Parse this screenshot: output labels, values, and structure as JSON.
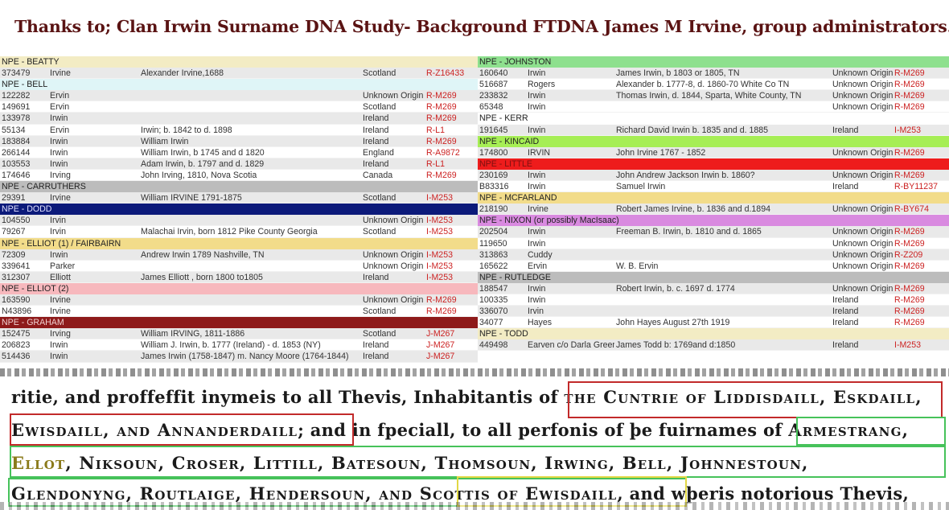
{
  "header": {
    "title": "Thanks to; Clan Irwin Surname DNA Study- Background FTDNA James M Irvine, group administrators."
  },
  "colors": {
    "title": "#5a1313",
    "haplogroup": "#cc2222",
    "box_red": "#c22a2a",
    "box_green": "#46c25a",
    "box_yellow": "#e2d845"
  },
  "left_groups": [
    {
      "name": "NPE - BEATTY",
      "color": "#f3ecc4",
      "text": "#222222",
      "rows": [
        [
          "373479",
          "Irvine",
          "Alexander Irvine,1688",
          "Scotland",
          "R-Z16433"
        ]
      ]
    },
    {
      "name": "NPE - BELL",
      "color": "#dff5f7",
      "text": "#222222",
      "rows": [
        [
          "122282",
          "Ervin",
          "",
          "Unknown Origin",
          "R-M269"
        ],
        [
          "149691",
          "Ervin",
          "",
          "Scotland",
          "R-M269"
        ],
        [
          "133978",
          "Irwin",
          "",
          "Ireland",
          "R-M269"
        ],
        [
          "55134",
          "Ervin",
          "Irwin; b. 1842 to d. 1898",
          "Ireland",
          "R-L1"
        ],
        [
          "183884",
          "Irwin",
          "William Irwin",
          "Ireland",
          "R-M269"
        ],
        [
          "266144",
          "Irwin",
          "William Irwin, b 1745 and d 1820",
          "England",
          "R-A9872"
        ],
        [
          "103553",
          "Irwin",
          "Adam Irwin, b. 1797 and d. 1829",
          "Ireland",
          "R-L1"
        ],
        [
          "174646",
          "Irving",
          "John Irving, 1810, Nova Scotia",
          "Canada",
          "R-M269"
        ]
      ]
    },
    {
      "name": "NPE - CARRUTHERS",
      "color": "#bcbcbc",
      "text": "#222222",
      "rows": [
        [
          "29391",
          "Irvine",
          "William IRVINE 1791-1875",
          "Scotland",
          "I-M253"
        ]
      ]
    },
    {
      "name": "NPE - DODD",
      "color": "#0c1a7a",
      "text": "#e0e0ff",
      "rows": [
        [
          "104550",
          "Irvin",
          "",
          "Unknown Origin",
          "I-M253"
        ],
        [
          "79267",
          "Irvin",
          "Malachai Irvin, born 1812 Pike County Georgia",
          "Scotland",
          "I-M253"
        ]
      ]
    },
    {
      "name": "NPE - ELLIOT (1) / FAIRBAIRN",
      "color": "#f2dc8a",
      "text": "#222222",
      "rows": [
        [
          "72309",
          "Irwin",
          "Andrew Irwin 1789 Nashville, TN",
          "Unknown Origin",
          "I-M253"
        ],
        [
          "339641",
          "Parker",
          "",
          "Unknown Origin",
          "I-M253"
        ],
        [
          "312307",
          "Elliott",
          "James Elliott , born 1800 to1805",
          "Ireland",
          "I-M253"
        ]
      ]
    },
    {
      "name": "NPE - ELLIOT (2)",
      "color": "#f7b8bd",
      "text": "#222222",
      "rows": [
        [
          "163590",
          "Irvine",
          "",
          "Unknown Origin",
          "R-M269"
        ],
        [
          "N43896",
          "Irvine",
          "",
          "Scotland",
          "R-M269"
        ]
      ]
    },
    {
      "name": "NPE - GRAHAM",
      "color": "#8e1a1a",
      "text": "#f0d0d0",
      "rows": [
        [
          "152475",
          "Irving",
          "William IRVING, 1811-1886",
          "Scotland",
          "J-M267"
        ],
        [
          "206823",
          "Irwin",
          "William J. Irwin, b. 1777 (Ireland) - d. 1853 (NY)",
          "Ireland",
          "J-M267"
        ],
        [
          "514436",
          "Irwin",
          "James Irwin (1758-1847) m. Nancy Moore (1764-1844)",
          "Ireland",
          "J-M267"
        ]
      ]
    }
  ],
  "right_groups": [
    {
      "name": "NPE - JOHNSTON",
      "color": "#8ee08e",
      "text": "#222222",
      "rows": [
        [
          "160640",
          "Irwin",
          "James Irwin, b 1803 or 1805, TN",
          "Unknown Origin",
          "R-M269"
        ],
        [
          "516687",
          "Rogers",
          "Alexander b. 1777-8, d. 1860-70 White Co TN",
          "Unknown Origin",
          "R-M269"
        ],
        [
          "233832",
          "Irwin",
          "Thomas Irwin, d. 1844, Sparta, White County, TN",
          "Unknown Origin",
          "R-M269"
        ],
        [
          "65348",
          "Irwin",
          "",
          "Unknown Origin",
          "R-M269"
        ]
      ]
    },
    {
      "name": "NPE - KERR",
      "color": "#ffffff",
      "text": "#222222",
      "rows": [
        [
          "191645",
          "Irwin",
          "Richard David Irwin b. 1835 and d. 1885",
          "Ireland",
          "I-M253"
        ]
      ]
    },
    {
      "name": "NPE - KINCAID",
      "color": "#a6ee55",
      "text": "#222222",
      "rows": [
        [
          "174800",
          "IRVIN",
          "John Irvine 1767 - 1852",
          "Unknown Origin",
          "R-M269"
        ]
      ]
    },
    {
      "name": "NPE - LITTLE",
      "color": "#ee1c1c",
      "text": "#7a1010",
      "rows": [
        [
          "230169",
          "Irwin",
          "John Andrew Jackson Irwin b. 1860?",
          "Unknown Origin",
          "R-M269"
        ],
        [
          "B83316",
          "Irwin",
          "Samuel Irwin",
          "Ireland",
          "R-BY11237"
        ]
      ]
    },
    {
      "name": "NPE - MCFARLAND",
      "color": "#f2dc8a",
      "text": "#222222",
      "rows": [
        [
          "218190",
          "Irvine",
          "Robert James Irvine, b. 1836 and d.1894",
          "Unknown Origin",
          "R-BY674"
        ]
      ]
    },
    {
      "name": "NPE - NIXON (or possibly MacIsaac)",
      "color": "#d98ae0",
      "text": "#222222",
      "rows": [
        [
          "202504",
          "Irwin",
          "Freeman B. Irwin, b. 1810 and d. 1865",
          "Unknown Origin",
          "R-M269"
        ],
        [
          "119650",
          "Irwin",
          "",
          "Unknown Origin",
          "R-M269"
        ],
        [
          "313863",
          "Cuddy",
          "",
          "Unknown Origin",
          "R-Z209"
        ],
        [
          "165622",
          "Ervin",
          "W. B. Ervin",
          "Unknown Origin",
          "R-M269"
        ]
      ]
    },
    {
      "name": "NPE - RUTLEDGE",
      "color": "#bcbcbc",
      "text": "#222222",
      "rows": [
        [
          "188547",
          "Irwin",
          "Robert Irwin, b. c. 1697 d. 1774",
          "Unknown Origin",
          "R-M269"
        ],
        [
          "100335",
          "Irwin",
          "",
          "Ireland",
          "R-M269"
        ],
        [
          "336070",
          "Irvin",
          "",
          "Ireland",
          "R-M269"
        ],
        [
          "34077",
          "Hayes",
          "John Hayes August 27th 1919",
          "Ireland",
          "R-M269"
        ]
      ]
    },
    {
      "name": "NPE - TODD",
      "color": "#f3ecc4",
      "text": "#222222",
      "rows": [
        [
          "449498",
          "Earven c/o Darla Greer",
          "James Todd b: 1769and d:1850",
          "Ireland",
          "I-M253"
        ]
      ]
    }
  ],
  "scan": {
    "l1a": "ritie, and proffeffit inymeis to all Thevis, Inhabitantis of ",
    "l1b": "the Cuntrie of Liddisdaill, Eskdaill,",
    "l2a": "Ewisdaill, and Annanderdaill",
    "l2b": "; and in fpeciall, to all perfonis of þe fuirnames of ",
    "l2c": "Armestrang,",
    "l3a": "Ellot",
    "l3b": ", Niksoun, Croser, Littill, Batesoun, Thomsoun, Irwing, Bell, Johnnestoun,",
    "l4a": "Glendonyng, Routlaige, Hendersoun, and ",
    "l4b": "Scottis of Ewisdaill",
    "l4c": ", and wþeris notorious Thevis,"
  }
}
